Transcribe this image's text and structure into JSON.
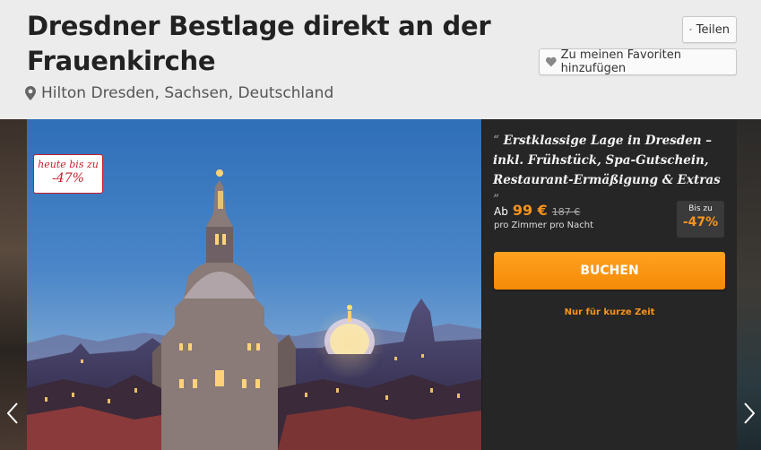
{
  "header": {
    "title": "Dresdner Bestlage direkt an der Frauenkirche",
    "location": "Hilton Dresden, Sachsen, Deutschland"
  },
  "actions": {
    "share_label": "Teilen",
    "favorite_label": "Zu meinen Favoriten hinzufügen"
  },
  "badge": {
    "line1": "heute bis zu",
    "line2": "-47%"
  },
  "offer": {
    "quote_open": "“",
    "quote": "Erstklassige Lage in Dresden – inkl. Frühstück, Spa-Gutschein, Restaurant-Ermäßigung & Extras",
    "quote_close": "”",
    "price_prefix": "Ab",
    "price": "99 €",
    "old_price": "187 €",
    "per_unit": "pro Zimmer pro Nacht",
    "discount_label": "Bis zu",
    "discount_value": "-47%",
    "book_label": "BUCHEN",
    "urgency": "Nur für kurze Zeit"
  },
  "gallery": {
    "prev_icon": "chevron-left-icon",
    "next_icon": "chevron-right-icon"
  },
  "colors": {
    "accent": "#f7941d",
    "badge_red": "#c81c2c",
    "panel_bg": "#262626"
  }
}
